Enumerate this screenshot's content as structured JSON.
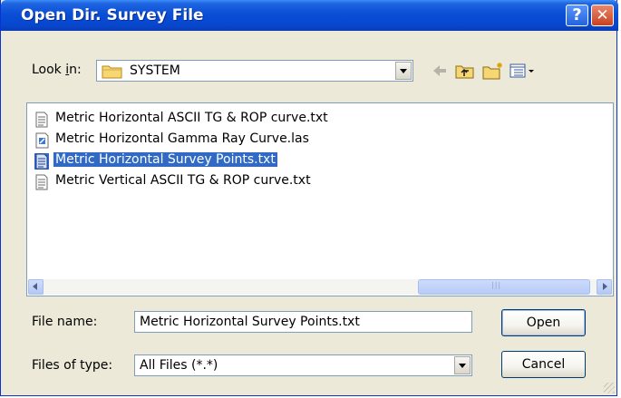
{
  "dialog": {
    "title": "Open Dir. Survey File"
  },
  "lookin": {
    "label_prefix": "Look ",
    "label_key": "i",
    "label_suffix": "n:",
    "value": "SYSTEM"
  },
  "files": [
    {
      "name": "Metric Horizontal ASCII TG & ROP curve.txt",
      "icon": "text-file-icon",
      "selected": false
    },
    {
      "name": "Metric Horizontal Gamma Ray Curve.las",
      "icon": "las-file-icon",
      "selected": false
    },
    {
      "name": "Metric Horizontal Survey Points.txt",
      "icon": "text-file-icon",
      "selected": true
    },
    {
      "name": "Metric Vertical ASCII TG & ROP curve.txt",
      "icon": "text-file-icon",
      "selected": false
    }
  ],
  "form": {
    "filename_label": "File name:",
    "filename_value": "Metric Horizontal Survey Points.txt",
    "filetype_label": "Files of type:",
    "filetype_value": "All Files (*.*)"
  },
  "buttons": {
    "open": "Open",
    "cancel": "Cancel"
  },
  "colors": {
    "titlebar": "#0a4fd6",
    "selection": "#316ac5",
    "dialog_bg": "#ece9d8"
  }
}
